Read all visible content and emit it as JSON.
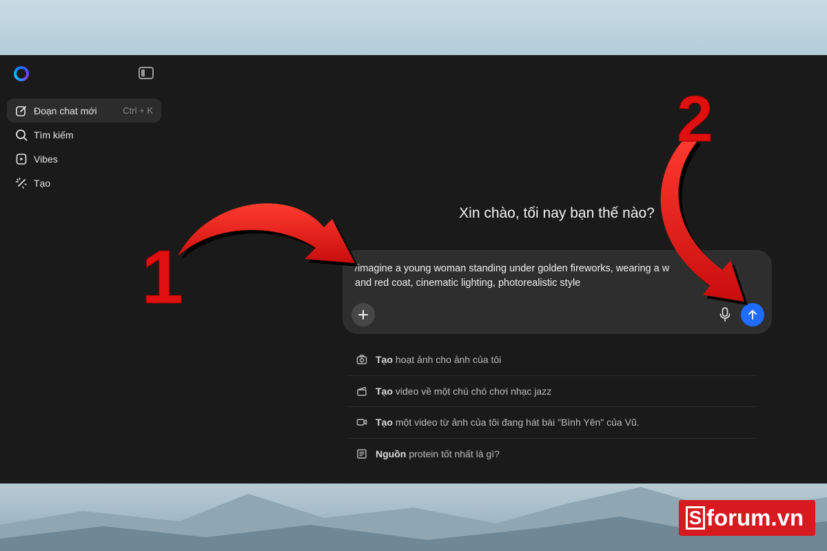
{
  "sidebar": {
    "items": [
      {
        "label": "Đoạn chat mới",
        "shortcut": "Ctrl + K",
        "icon": "edit-icon"
      },
      {
        "label": "Tìm kiếm",
        "icon": "search-icon"
      },
      {
        "label": "Vibes",
        "icon": "play-icon"
      },
      {
        "label": "Tạo",
        "icon": "magic-wand-icon"
      }
    ]
  },
  "main": {
    "greeting": "Xin chào, tối nay bạn thế nào?",
    "composer": {
      "value": "/imagine a young woman standing under golden fireworks, wearing a w\nand red coat, cinematic lighting, photorealistic style"
    },
    "suggestions": [
      {
        "bold": "Tạo",
        "text": "hoạt ảnh cho ảnh của tôi",
        "icon": "camera-animate-icon"
      },
      {
        "bold": "Tạo",
        "text": "video về một chú chó chơi nhạc jazz",
        "icon": "clapperboard-icon"
      },
      {
        "bold": "Tạo",
        "text": "một video từ ảnh của tôi đang hát bài \"Bình Yên\" của Vũ.",
        "icon": "video-camera-icon"
      },
      {
        "bold": "Nguồn",
        "text": "protein tốt nhất là gì?",
        "icon": "article-icon"
      }
    ]
  },
  "annotations": {
    "step1": "1",
    "step2": "2"
  },
  "watermark": {
    "s": "S",
    "text": "forum.vn"
  },
  "colors": {
    "accent": "#1f6cff",
    "annotation": "#e01010",
    "watermark": "#d71920"
  }
}
